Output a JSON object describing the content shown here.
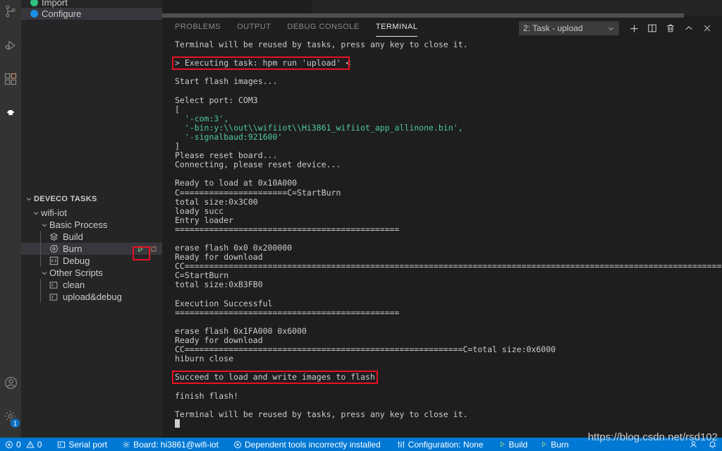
{
  "activitybar": {
    "items": [
      {
        "name": "source-control-icon",
        "title": "Source Control"
      },
      {
        "name": "run-debug-icon",
        "title": "Run and Debug"
      },
      {
        "name": "extensions-icon",
        "title": "Extensions"
      },
      {
        "name": "deveco-icon",
        "title": "DevEco Home"
      }
    ],
    "bottom": [
      {
        "name": "accounts-icon",
        "title": "Accounts"
      },
      {
        "name": "settings-gear-icon",
        "title": "Manage",
        "badge": "1"
      }
    ]
  },
  "sidebar": {
    "top_items": [
      {
        "label": "Import",
        "dot": "#2ec27e"
      },
      {
        "label": "Configure",
        "dot": "#1a8fe3"
      }
    ],
    "section_title": "DEVECO TASKS",
    "tree": [
      {
        "label": "wifi-iot",
        "type": "folder",
        "depth": 1,
        "expanded": true
      },
      {
        "label": "Basic Process",
        "type": "folder",
        "depth": 2,
        "expanded": true
      },
      {
        "label": "Build",
        "type": "task",
        "icon": "layers-icon",
        "depth": 3
      },
      {
        "label": "Burn",
        "type": "task",
        "icon": "burn-icon",
        "depth": 3,
        "selected": true
      },
      {
        "label": "Debug",
        "type": "task",
        "icon": "code-icon",
        "depth": 3
      },
      {
        "label": "Other Scripts",
        "type": "folder",
        "depth": 2,
        "expanded": true
      },
      {
        "label": "clean",
        "type": "script",
        "icon": "terminal-icon",
        "depth": 3
      },
      {
        "label": "upload&debug",
        "type": "script",
        "icon": "terminal-icon",
        "depth": 3
      }
    ],
    "row_actions": {
      "run": "run-task-icon",
      "stop": "stop-task-icon"
    }
  },
  "panel": {
    "tabs": [
      {
        "label": "PROBLEMS",
        "active": false
      },
      {
        "label": "OUTPUT",
        "active": false
      },
      {
        "label": "DEBUG CONSOLE",
        "active": false
      },
      {
        "label": "TERMINAL",
        "active": true
      }
    ],
    "terminal_selector": "2: Task - upload",
    "actions": [
      {
        "name": "new-terminal-icon",
        "label": "+"
      },
      {
        "name": "split-terminal-icon",
        "label": "split"
      },
      {
        "name": "kill-terminal-icon",
        "label": "trash"
      },
      {
        "name": "maximize-panel-icon",
        "label": "chevron-up"
      },
      {
        "name": "close-panel-icon",
        "label": "close"
      }
    ]
  },
  "terminal": {
    "lines": [
      {
        "text": "Terminal will be reused by tasks, press any key to close it."
      },
      {
        "text": ""
      },
      {
        "text": "> Executing task: hpm run 'upload' <",
        "highlight": true
      },
      {
        "text": ""
      },
      {
        "text": "Start flash images..."
      },
      {
        "text": ""
      },
      {
        "text": "Select port: COM3"
      },
      {
        "text": "["
      },
      {
        "text": "  '-com:3',",
        "color": "green"
      },
      {
        "text": "  '-bin:y:\\\\out\\\\wifiiot\\\\Hi3861_wifiiot_app_allinone.bin',",
        "color": "green"
      },
      {
        "text": "  '-signalbaud:921600'",
        "color": "green"
      },
      {
        "text": "]"
      },
      {
        "text": "Please reset board..."
      },
      {
        "text": "Connecting, please reset device..."
      },
      {
        "text": ""
      },
      {
        "text": "Ready to load at 0x10A000"
      },
      {
        "text": "C======================C=StartBurn"
      },
      {
        "text": "total size:0x3C00"
      },
      {
        "text": "loady succ"
      },
      {
        "text": "Entry loader"
      },
      {
        "text": "=============================================="
      },
      {
        "text": ""
      },
      {
        "text": "erase flash 0x0 0x200000"
      },
      {
        "text": "Ready for download"
      },
      {
        "text": "CC==================================================================================================================================================================================================================================="
      },
      {
        "text": "C=StartBurn"
      },
      {
        "text": "total size:0xB3FB0"
      },
      {
        "text": ""
      },
      {
        "text": "Execution Successful"
      },
      {
        "text": "=============================================="
      },
      {
        "text": ""
      },
      {
        "text": "erase flash 0x1FA000 0x6000"
      },
      {
        "text": "Ready for download"
      },
      {
        "text": "CC=========================================================C=total size:0x6000"
      },
      {
        "text": "hiburn close"
      },
      {
        "text": ""
      },
      {
        "text": "Succeed to load and write images to flash.",
        "highlight": true
      },
      {
        "text": ""
      },
      {
        "text": "finish flash!"
      },
      {
        "text": ""
      },
      {
        "text": "Terminal will be reused by tasks, press any key to close it."
      },
      {
        "text": "",
        "cursor": true
      }
    ]
  },
  "statusbar": {
    "left": [
      {
        "name": "problems-status",
        "icon": "error-icon",
        "label": "0",
        "icon2": "warning-icon",
        "label2": "0"
      },
      {
        "name": "serial-port-status",
        "icon": "terminal-box-icon",
        "label": "Serial port"
      },
      {
        "name": "board-status",
        "icon": "gear-icon",
        "label": "Board: hi3861@wifi-iot"
      },
      {
        "name": "dependent-tools-status",
        "icon": "error-circle-icon",
        "label": "Dependent tools incorrectly installed"
      },
      {
        "name": "configuration-status",
        "icon": "settings-sliders-icon",
        "label": "Configuration: None"
      },
      {
        "name": "build-status",
        "icon": "play-icon",
        "label": "Build"
      },
      {
        "name": "burn-status",
        "icon": "play-icon",
        "label": "Burn"
      }
    ],
    "right": [
      {
        "name": "remote-status",
        "icon": "account-icon"
      },
      {
        "name": "notifications-status",
        "icon": "bell-icon"
      }
    ]
  },
  "watermark": "https://blog.csdn.net/rsd102",
  "colors": {
    "accent_blue": "#0078d4",
    "terminal_green": "#4ec9a0",
    "highlight_red": "#e81123",
    "selected_row": "#37373d",
    "sidebar_bg": "#252526",
    "editor_bg": "#1e1e1e",
    "activitybar_bg": "#333333"
  }
}
